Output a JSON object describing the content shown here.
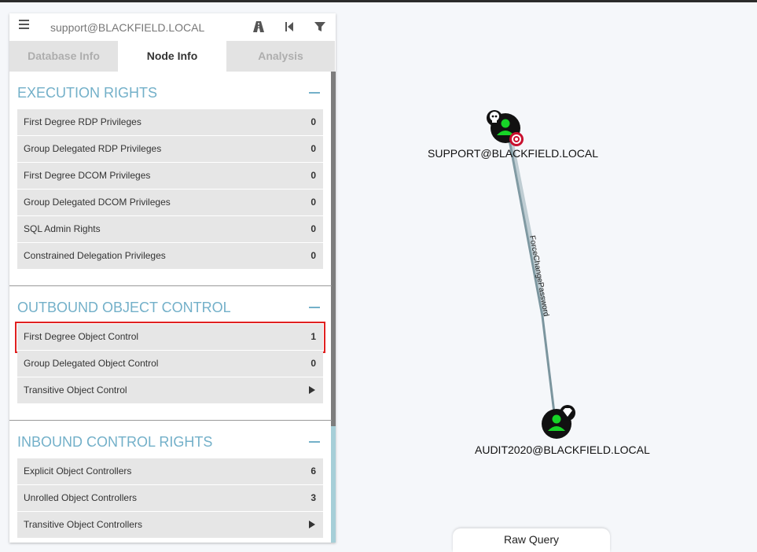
{
  "search": {
    "value": "support@BLACKFIELD.LOCAL"
  },
  "toolbar": {
    "icons": [
      "menu-icon",
      "pathfinding-icon",
      "back-icon",
      "filter-icon"
    ]
  },
  "tabs": [
    {
      "label": "Database Info",
      "active": false
    },
    {
      "label": "Node Info",
      "active": true
    },
    {
      "label": "Analysis",
      "active": false
    }
  ],
  "sections": {
    "execution": {
      "title": "EXECUTION RIGHTS",
      "rows": [
        {
          "label": "First Degree RDP Privileges",
          "value": "0"
        },
        {
          "label": "Group Delegated RDP Privileges",
          "value": "0"
        },
        {
          "label": "First Degree DCOM Privileges",
          "value": "0"
        },
        {
          "label": "Group Delegated DCOM Privileges",
          "value": "0"
        },
        {
          "label": "SQL Admin Rights",
          "value": "0"
        },
        {
          "label": "Constrained Delegation Privileges",
          "value": "0"
        }
      ]
    },
    "outbound": {
      "title": "OUTBOUND OBJECT CONTROL",
      "rows": [
        {
          "label": "First Degree Object Control",
          "value": "1"
        },
        {
          "label": "Group Delegated Object Control",
          "value": "0"
        },
        {
          "label": "Transitive Object Control",
          "value": ""
        }
      ]
    },
    "inbound": {
      "title": "INBOUND CONTROL RIGHTS",
      "rows": [
        {
          "label": "Explicit Object Controllers",
          "value": "6"
        },
        {
          "label": "Unrolled Object Controllers",
          "value": "3"
        },
        {
          "label": "Transitive Object Controllers",
          "value": ""
        }
      ]
    }
  },
  "graph": {
    "nodes": [
      {
        "label": "SUPPORT@BLACKFIELD.LOCAL",
        "type": "user",
        "badges": [
          "skull-icon",
          "target-icon"
        ]
      },
      {
        "label": "AUDIT2020@BLACKFIELD.LOCAL",
        "type": "user",
        "badges": [
          "diamond-icon"
        ]
      }
    ],
    "edges": [
      {
        "label": "ForceChangePassword"
      }
    ]
  },
  "raw_query": {
    "label": "Raw Query"
  },
  "colors": {
    "section": "#73b0c9",
    "node": "#17d427",
    "highlight": "#e02020",
    "edge": "#6e8a93"
  }
}
